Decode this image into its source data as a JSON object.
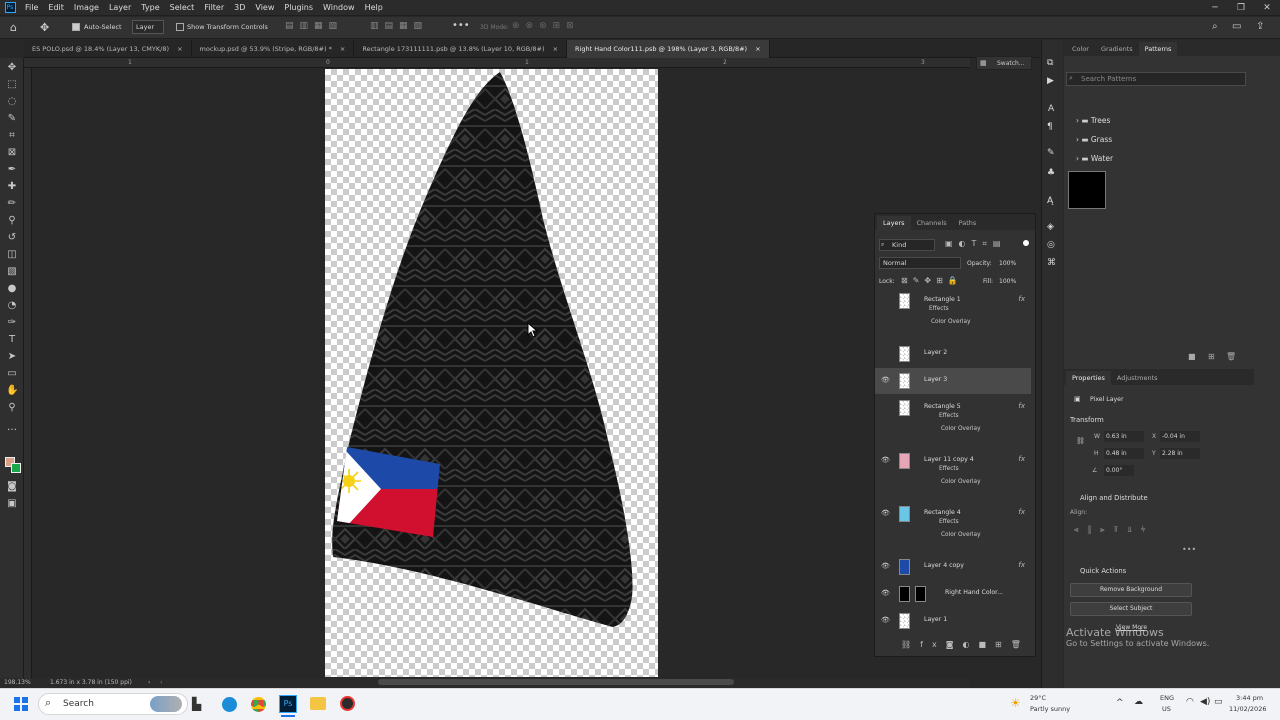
{
  "menu": [
    "File",
    "Edit",
    "Image",
    "Layer",
    "Type",
    "Select",
    "Filter",
    "3D",
    "View",
    "Plugins",
    "Window",
    "Help"
  ],
  "options": {
    "auto_select": "Auto-Select",
    "layer_dropdown": "Layer",
    "show_transform": "Show Transform Controls",
    "mode_3d": "3D Mode:"
  },
  "tabs": [
    {
      "label": "ES POLO.psd @ 18.4% (Layer 13, CMYK/8)",
      "active": false
    },
    {
      "label": "mockup.psd @ 53.9% (Stripe, RGB/8#) *",
      "active": false
    },
    {
      "label": "Rectangle 173111111.psb @ 13.8% (Layer 10, RGB/8#)",
      "active": false
    },
    {
      "label": "Right Hand Color111.psb @ 198% (Layer 3, RGB/8#)",
      "active": true
    }
  ],
  "ruler_ticks": [
    "1",
    "0",
    "1",
    "2",
    "3"
  ],
  "status": {
    "zoom": "198.13%",
    "size": "1.673 in x 3.78 in (150 ppi)"
  },
  "swatches_label": "Swatch...",
  "right_top": {
    "tabs": [
      "Color",
      "Gradients",
      "Patterns"
    ],
    "search_placeholder": "Search Patterns",
    "folders": [
      "Trees",
      "Grass",
      "Water"
    ]
  },
  "layers_panel": {
    "tabs": [
      "Layers",
      "Channels",
      "Paths"
    ],
    "kind": "Kind",
    "blend": "Normal",
    "opacity_label": "Opacity:",
    "opacity": "100%",
    "lock_label": "Lock:",
    "fill_label": "Fill:",
    "fill": "100%",
    "effects_label": "Effects",
    "overlay_label": "Color Overlay",
    "layers": [
      {
        "name": "Rectangle 1",
        "visible": false,
        "fx": true
      },
      {
        "name": "Layer 2",
        "visible": false,
        "fx": false
      },
      {
        "name": "Layer 3",
        "visible": true,
        "fx": false,
        "selected": true
      },
      {
        "name": "Rectangle 5",
        "visible": false,
        "fx": true
      },
      {
        "name": "Layer 11 copy 4",
        "visible": true,
        "fx": true
      },
      {
        "name": "Rectangle 4",
        "visible": true,
        "fx": true
      },
      {
        "name": "Layer 4 copy",
        "visible": true,
        "fx": true
      },
      {
        "name": "Right Hand Color...",
        "visible": true,
        "fx": false
      },
      {
        "name": "Layer 1",
        "visible": true,
        "fx": false
      }
    ]
  },
  "properties": {
    "tabs": [
      "Properties",
      "Adjustments"
    ],
    "kind": "Pixel Layer",
    "transform": "Transform",
    "w": "0.63 in",
    "x": "-0.04 in",
    "h": "0.48 in",
    "y": "2.28 in",
    "angle": "0.00°",
    "align": "Align and Distribute",
    "align_label": "Align:",
    "quick": "Quick Actions",
    "remove_bg": "Remove Background",
    "select_subject": "Select Subject",
    "view_more": "View More"
  },
  "activate": {
    "title": "Activate Windows",
    "sub": "Go to Settings to activate Windows."
  },
  "taskbar": {
    "search": "Search",
    "weather_temp": "29°C",
    "weather_desc": "Partly sunny",
    "lang1": "ENG",
    "lang2": "US",
    "time": "3:44 pm",
    "date": "11/02/2026"
  },
  "colors": {
    "accent": "#31a8ff",
    "flag_blue": "#1d4aa8",
    "flag_red": "#d0102e",
    "flag_sun": "#f7d117"
  }
}
